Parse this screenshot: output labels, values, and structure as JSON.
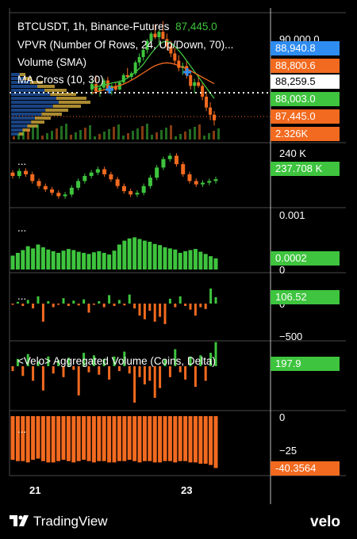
{
  "colors": {
    "up": "#3ec43e",
    "down": "#f26a1f",
    "blue_tag": "#2f8cf0",
    "white": "#ffffff",
    "grid": "#2a2a2a",
    "sep": "#4a4a4a"
  },
  "overlay": {
    "symbol": "BTCUSDT, 1h, Binance-Futures",
    "last_price": "87,445.0",
    "vpvr": "VPVR (Number Of Rows, 24, Up/Down, 70)...",
    "volume": "Volume (SMA)",
    "ma_cross": "MA Cross (10, 30)",
    "velo_title": "<Velo> Aggregated Volume (Coins, Delta)"
  },
  "price_axis": {
    "top_label": "90,000.0",
    "tags": [
      "88,940.8",
      "88,800.6",
      "88,259.5",
      "88,003.0",
      "87,445.0",
      "2.326K"
    ]
  },
  "pane2": {
    "axis_label": "240 K",
    "value": "237.708 K",
    "dots": "..."
  },
  "pane3": {
    "axis_top": "0.001",
    "axis_bottom": "0",
    "value": "0.0002",
    "dots": "..."
  },
  "pane4": {
    "axis_mid": "0",
    "axis_bottom": "−500",
    "value": "106.52",
    "dots": "..."
  },
  "pane5": {
    "value": "197.9"
  },
  "pane6": {
    "axis_top": "0",
    "axis_mid": "−25",
    "value": "-40.3564",
    "dots": "..."
  },
  "time_axis": {
    "ticks": [
      "21",
      "23"
    ]
  },
  "branding": {
    "left": "TradingView",
    "right": "velo"
  },
  "chart_data": [
    {
      "type": "candlestick",
      "title": "BTCUSDT, 1h, Binance-Futures",
      "ohlc": [
        [
          88300,
          88550,
          88150,
          88450
        ],
        [
          88450,
          88700,
          88350,
          88250
        ],
        [
          88250,
          88400,
          88100,
          88350
        ],
        [
          88350,
          88600,
          88300,
          88550
        ],
        [
          88550,
          88650,
          88200,
          88300
        ],
        [
          88300,
          88450,
          88150,
          88400
        ],
        [
          88400,
          88500,
          88250,
          88300
        ],
        [
          88300,
          88550,
          88280,
          88500
        ],
        [
          88500,
          88750,
          88450,
          88700
        ],
        [
          88700,
          88900,
          88600,
          88650
        ],
        [
          88650,
          88800,
          88550,
          88750
        ],
        [
          88750,
          89100,
          88700,
          89050
        ],
        [
          89050,
          89300,
          88950,
          89200
        ],
        [
          89200,
          89450,
          89100,
          89400
        ],
        [
          89400,
          89700,
          89300,
          89650
        ],
        [
          89650,
          89900,
          89500,
          89850
        ],
        [
          89850,
          90100,
          89700,
          89750
        ],
        [
          89750,
          89950,
          89550,
          89900
        ],
        [
          89900,
          90200,
          89800,
          89700
        ],
        [
          89700,
          89850,
          89400,
          89500
        ],
        [
          89500,
          89650,
          89200,
          89300
        ],
        [
          89300,
          89450,
          89000,
          89100
        ],
        [
          89100,
          89250,
          88800,
          88900
        ],
        [
          88900,
          89050,
          88700,
          88950
        ],
        [
          88950,
          89100,
          88600,
          88700
        ],
        [
          88700,
          88800,
          88300,
          88400
        ],
        [
          88400,
          88600,
          88200,
          88500
        ],
        [
          88500,
          88700,
          88350,
          88400
        ],
        [
          88400,
          88500,
          88000,
          88100
        ],
        [
          88100,
          88250,
          87700,
          87800
        ],
        [
          87800,
          87950,
          87450,
          87600
        ],
        [
          87600,
          87700,
          87300,
          87445
        ]
      ],
      "ma_fast": [
        88350,
        88380,
        88400,
        88420,
        88450,
        88480,
        88500,
        88520,
        88560,
        88620,
        88700,
        88780,
        88880,
        89000,
        89150,
        89300,
        89430,
        89550,
        89620,
        89640,
        89600,
        89500,
        89380,
        89250,
        89100,
        88950,
        88800,
        88650,
        88500,
        88350,
        88200,
        88050
      ],
      "ma_slow": [
        88200,
        88230,
        88260,
        88290,
        88320,
        88350,
        88380,
        88410,
        88450,
        88500,
        88560,
        88620,
        88690,
        88760,
        88830,
        88900,
        88960,
        89000,
        89030,
        89040,
        89030,
        89000,
        88960,
        88920,
        88870,
        88820,
        88760,
        88700,
        88640,
        88580,
        88520,
        88460
      ],
      "price_levels": [
        "88,940.8",
        "88,800.6",
        "88,259.5",
        "88,003.0",
        "87,445.0"
      ],
      "volume_label": "2.326K"
    },
    {
      "type": "candlestick",
      "pane": 2,
      "last": 237.708,
      "ticks": [
        "240 K"
      ],
      "close": [
        237.9,
        238.2,
        238.0,
        237.6,
        237.3,
        237.1,
        236.9,
        236.7,
        236.8,
        237.2,
        237.6,
        237.9,
        238.1,
        238.3,
        238.0,
        237.7,
        237.3,
        237.0,
        236.8,
        236.9,
        237.3,
        237.8,
        238.4,
        238.9,
        239.1,
        238.6,
        238.0,
        237.6,
        237.4,
        237.5,
        237.6,
        237.708
      ]
    },
    {
      "type": "bar",
      "pane": 3,
      "ylim": [
        0,
        0.001
      ],
      "last": 0.0002,
      "values": [
        0.00025,
        0.0003,
        0.00035,
        0.00042,
        0.00038,
        0.00045,
        0.0004,
        0.00036,
        0.00033,
        0.0003,
        0.00034,
        0.00037,
        0.00035,
        0.00032,
        0.0003,
        0.00028,
        0.00031,
        0.00033,
        0.0003,
        0.00027,
        0.00034,
        0.00045,
        0.00052,
        0.00056,
        0.00058,
        0.00055,
        0.00052,
        0.0005,
        0.00046,
        0.00044,
        0.0004,
        0.00038,
        0.00036,
        0.0003,
        0.00033,
        0.00035,
        0.00037,
        0.00032,
        0.00028,
        0.00024,
        0.0002
      ]
    },
    {
      "type": "bar",
      "pane": 4,
      "ticks": [
        "0",
        "−500"
      ],
      "last": 106.52,
      "values": [
        -20,
        30,
        -40,
        60,
        -80,
        120,
        -300,
        40,
        -60,
        -20,
        90,
        -40,
        50,
        -30,
        70,
        -150,
        -20,
        40,
        -60,
        140,
        -40,
        60,
        -30,
        150,
        -80,
        -200,
        -260,
        -120,
        -300,
        -220,
        -340,
        80,
        -60,
        120,
        -40,
        -100,
        -200,
        -60,
        -90,
        250,
        106.52
      ]
    },
    {
      "type": "bar",
      "pane": 5,
      "title": "<Velo> Aggregated Volume (Coins, Delta)",
      "last": 197.9,
      "values": [
        -40,
        60,
        -80,
        100,
        -120,
        40,
        -200,
        80,
        -60,
        50,
        -90,
        70,
        -30,
        -240,
        110,
        -50,
        90,
        -70,
        60,
        -110,
        80,
        -40,
        120,
        -60,
        -300,
        -90,
        -150,
        -120,
        -260,
        -180,
        60,
        -90,
        140,
        -50,
        -110,
        80,
        -170,
        90,
        -120,
        110,
        197.9
      ]
    },
    {
      "type": "bar",
      "pane": 6,
      "ticks": [
        "0",
        "−25"
      ],
      "last": -40.3564,
      "values": [
        -34,
        -35,
        -35,
        -36,
        -34,
        -33,
        -35,
        -36,
        -36,
        -35,
        -34,
        -35,
        -36,
        -35,
        -34,
        -35,
        -36,
        -35,
        -35,
        -36,
        -36,
        -35,
        -35,
        -34,
        -35,
        -36,
        -35,
        -35,
        -36,
        -36,
        -35,
        -35,
        -36,
        -35,
        -35,
        -36,
        -36,
        -37,
        -37,
        -38,
        -40.3564
      ]
    }
  ]
}
